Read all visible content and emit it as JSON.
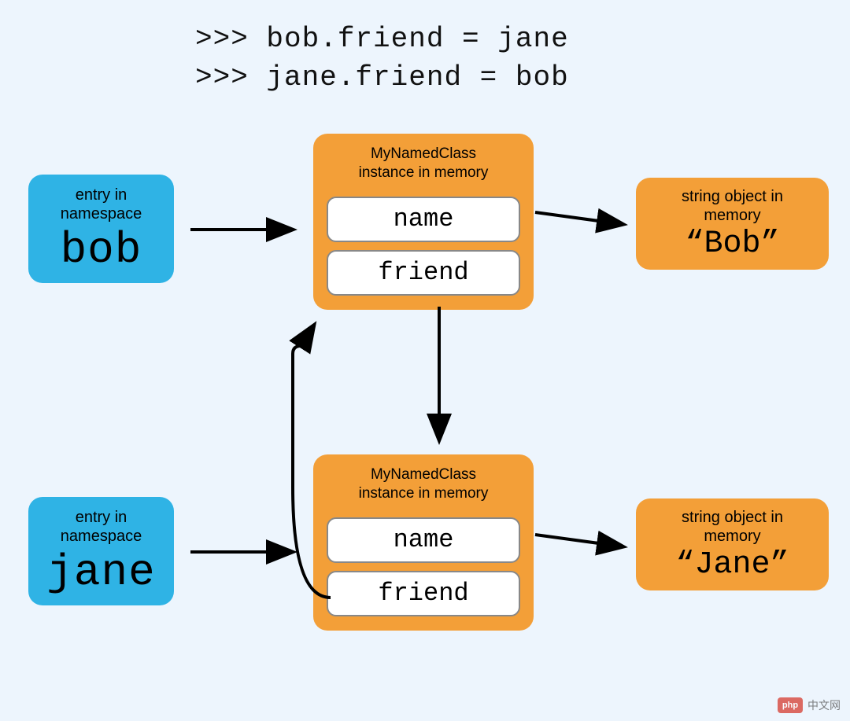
{
  "code": {
    "line1": ">>> bob.friend = jane",
    "line2": ">>> jane.friend = bob"
  },
  "namespace": {
    "entry_label": "entry in\nnamespace",
    "bob": "bob",
    "jane": "jane"
  },
  "instance": {
    "label": "MyNamedClass\ninstance in memory",
    "attr_name": "name",
    "attr_friend": "friend"
  },
  "strings": {
    "label": "string object in\nmemory",
    "bob": "“Bob”",
    "jane": "“Jane”"
  },
  "watermark": {
    "logo": "php",
    "text": "中文网"
  },
  "chart_data": {
    "type": "diagram",
    "description": "Object reference diagram showing circular references between two Python class instances",
    "code_lines": [
      ">>> bob.friend = jane",
      ">>> jane.friend = bob"
    ],
    "nodes": [
      {
        "id": "ns_bob",
        "type": "namespace_entry",
        "label": "bob",
        "color": "#2fb3e5"
      },
      {
        "id": "ns_jane",
        "type": "namespace_entry",
        "label": "jane",
        "color": "#2fb3e5"
      },
      {
        "id": "inst_bob",
        "type": "instance",
        "class": "MyNamedClass",
        "attributes": [
          "name",
          "friend"
        ],
        "color": "#f39f38"
      },
      {
        "id": "inst_jane",
        "type": "instance",
        "class": "MyNamedClass",
        "attributes": [
          "name",
          "friend"
        ],
        "color": "#f39f38"
      },
      {
        "id": "str_bob",
        "type": "string",
        "value": "Bob",
        "color": "#f39f38"
      },
      {
        "id": "str_jane",
        "type": "string",
        "value": "Jane",
        "color": "#f39f38"
      }
    ],
    "edges": [
      {
        "from": "ns_bob",
        "to": "inst_bob"
      },
      {
        "from": "ns_jane",
        "to": "inst_jane"
      },
      {
        "from": "inst_bob",
        "attr": "name",
        "to": "str_bob"
      },
      {
        "from": "inst_jane",
        "attr": "name",
        "to": "str_jane"
      },
      {
        "from": "inst_bob",
        "attr": "friend",
        "to": "inst_jane"
      },
      {
        "from": "inst_jane",
        "attr": "friend",
        "to": "inst_bob"
      }
    ]
  }
}
